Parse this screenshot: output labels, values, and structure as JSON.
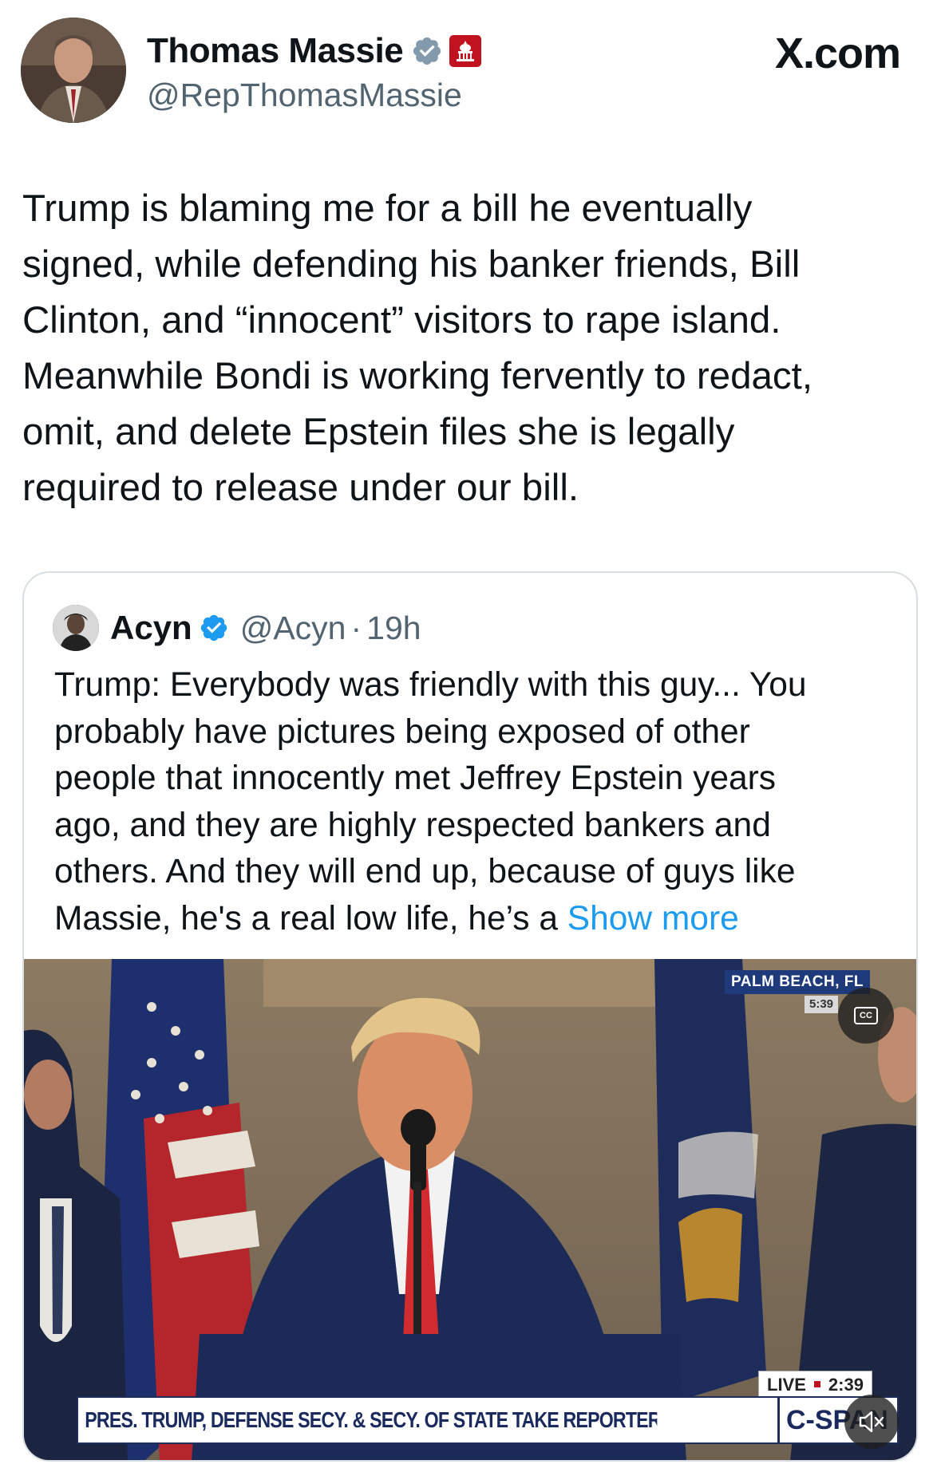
{
  "author": {
    "name": "Thomas Massie",
    "handle": "@RepThomasMassie",
    "avatar_icon": "profile-photo",
    "verified_color": "#829aab",
    "gov_badge_color": "#c1121f"
  },
  "brand": "X.com",
  "tweet": {
    "lines": [
      "Trump is blaming me for a bill he eventually",
      "signed, while defending his banker friends, Bill",
      "Clinton, and “innocent” visitors to rape island.",
      "Meanwhile Bondi is working fervently to redact,",
      "omit, and delete Epstein files she is legally",
      "required to release under our bill."
    ]
  },
  "quote": {
    "name": "Acyn",
    "handle": "@Acyn",
    "separator": "·",
    "time": "19h",
    "verified_color": "#1d9bf0",
    "lines": [
      "Trump: Everybody was friendly with this guy... You",
      "probably have pictures being exposed of other",
      "people that innocently met Jeffrey Epstein years",
      "ago, and they are highly respected bankers and",
      "others. And they will end up, because of guys like",
      "Massie, he's a real low life, he’s a "
    ],
    "show_more": "Show more",
    "video": {
      "location_tag": "PALM BEACH, FL",
      "time_tag": "5:39",
      "live_label": "LIVE",
      "live_time": "2:39",
      "chyron": "PRES. TRUMP, DEFENSE SECY. & SECY. OF STATE TAKE REPORTER QUESTIONS",
      "network": "C-SPAN",
      "cc_label": "CC"
    }
  }
}
